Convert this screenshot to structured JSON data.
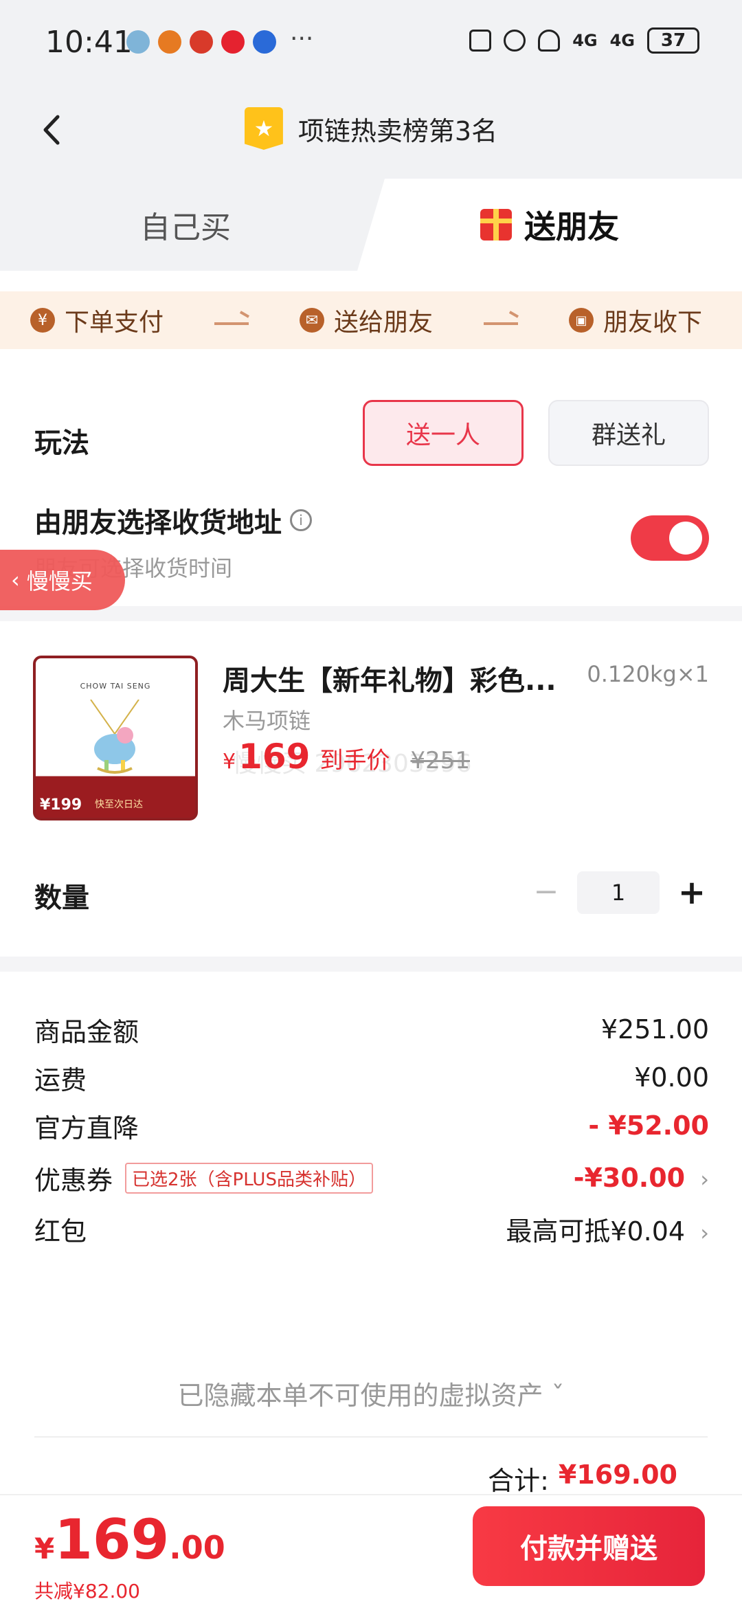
{
  "status_bar": {
    "time": "10:41",
    "more": "···",
    "signal_1": "4G",
    "signal_2": "4G",
    "battery": "37"
  },
  "header": {
    "title": "项链热卖榜第3名",
    "badge_icon": "star-icon"
  },
  "tabs": {
    "self": "自己买",
    "friend": "送朋友"
  },
  "steps": [
    {
      "icon": "¥",
      "label": "下单支付"
    },
    {
      "icon": "✉",
      "label": "送给朋友"
    },
    {
      "icon": "🎁",
      "label": "朋友收下"
    }
  ],
  "play": {
    "label": "玩法",
    "option_single": "送一人",
    "option_group": "群送礼",
    "address_label": "由朋友选择收货地址",
    "address_sub": "朋友可选择收货时间",
    "toggle_on": true
  },
  "float_buy": "慢慢买",
  "product": {
    "name": "周大生【新年礼物】彩色...",
    "weight": "0.120kg×1",
    "spec": "木马项链",
    "price_currency": "¥",
    "price": "169",
    "price_tag": "到手价",
    "original_price": "¥251",
    "watermark": "慢慢买 2962303396",
    "image": {
      "brand": "CHOW TAI SENG",
      "badge_price": "¥199",
      "badge_text": "快至次日达"
    }
  },
  "quantity": {
    "label": "数量",
    "value": "1",
    "minus": "−",
    "plus": "+"
  },
  "fees": {
    "goods_label": "商品金额",
    "goods_value": "¥251.00",
    "shipping_label": "运费",
    "shipping_value": "¥0.00",
    "discount_label": "官方直降",
    "discount_value": "- ¥52.00",
    "coupon_label": "优惠券",
    "coupon_tag": "已选2张（含PLUS品类补贴）",
    "coupon_value": "-¥30.00",
    "redpacket_label": "红包",
    "redpacket_value": "最高可抵¥0.04",
    "hidden_assets": "已隐藏本单不可使用的虚拟资产 ˇ",
    "total_label": "合计:",
    "total_value": "¥169.00"
  },
  "bottom": {
    "currency": "¥",
    "price_int": "169",
    "price_dec": ".00",
    "saved": "共减¥82.00",
    "pay_button": "付款并赠送"
  },
  "colors": {
    "accent_red": "#e8262f",
    "toggle_red": "#ef3b47",
    "step_bg": "#fdf1e6"
  }
}
